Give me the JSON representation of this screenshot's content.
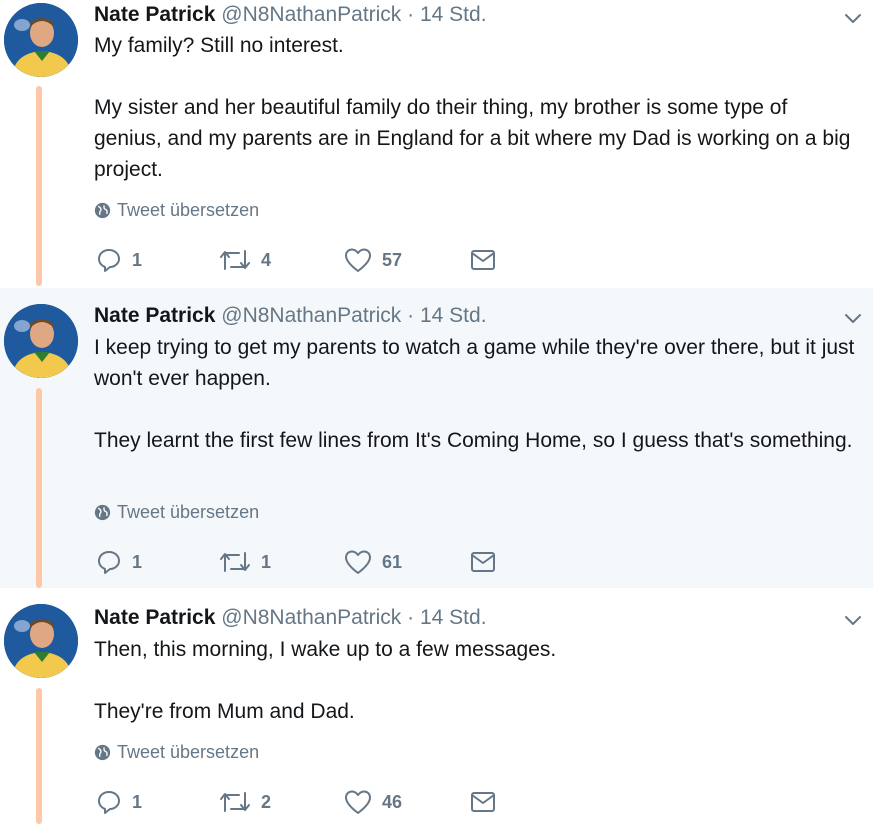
{
  "tweets": [
    {
      "name": "Nate Patrick",
      "handle": "@N8NathanPatrick",
      "time": "· 14 Std.",
      "paragraphs": [
        "My family? Still no interest.",
        "My sister and her beautiful family do their thing, my brother is some type of genius, and my parents are in England for a bit where my Dad is working on a big project."
      ],
      "translate": "Tweet übersetzen",
      "replies": "1",
      "retweets": "4",
      "likes": "57",
      "highlighted": false
    },
    {
      "name": "Nate Patrick",
      "handle": "@N8NathanPatrick",
      "time": "· 14 Std.",
      "paragraphs": [
        "I keep trying to get my parents to watch a game while they're over there, but it just won't ever happen.",
        "They learnt the first few lines from It's Coming Home, so I guess that's something."
      ],
      "translate": "Tweet übersetzen",
      "replies": "1",
      "retweets": "1",
      "likes": "61",
      "highlighted": true
    },
    {
      "name": "Nate Patrick",
      "handle": "@N8NathanPatrick",
      "time": "· 14 Std.",
      "paragraphs": [
        "Then, this morning, I wake up to a few messages.",
        "They're from Mum and Dad."
      ],
      "translate": "Tweet übersetzen",
      "replies": "1",
      "retweets": "2",
      "likes": "46",
      "highlighted": false
    }
  ],
  "icons": {
    "reply": "reply-icon",
    "retweet": "retweet-icon",
    "like": "heart-icon",
    "dm": "envelope-icon",
    "translate": "globe-icon",
    "more": "chevron-down-icon"
  },
  "colors": {
    "thread_line": "#fcc8a8",
    "highlight_bg": "#f5f8fa",
    "secondary_text": "#657786"
  }
}
